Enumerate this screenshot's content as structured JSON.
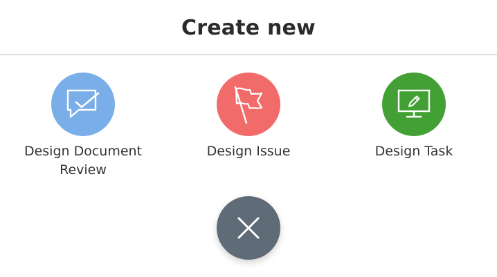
{
  "header": {
    "title": "Create new"
  },
  "options": [
    {
      "label_lines": [
        "Design Document",
        "Review"
      ],
      "icon": "chat-check-icon",
      "color": "#7aaee8"
    },
    {
      "label_lines": [
        "Design Issue"
      ],
      "icon": "flag-icon",
      "color": "#f26b6b"
    },
    {
      "label_lines": [
        "Design Task"
      ],
      "icon": "monitor-pencil-icon",
      "color": "#43a035"
    }
  ],
  "close_button": {
    "icon": "close-icon",
    "color": "#5f6b76"
  }
}
